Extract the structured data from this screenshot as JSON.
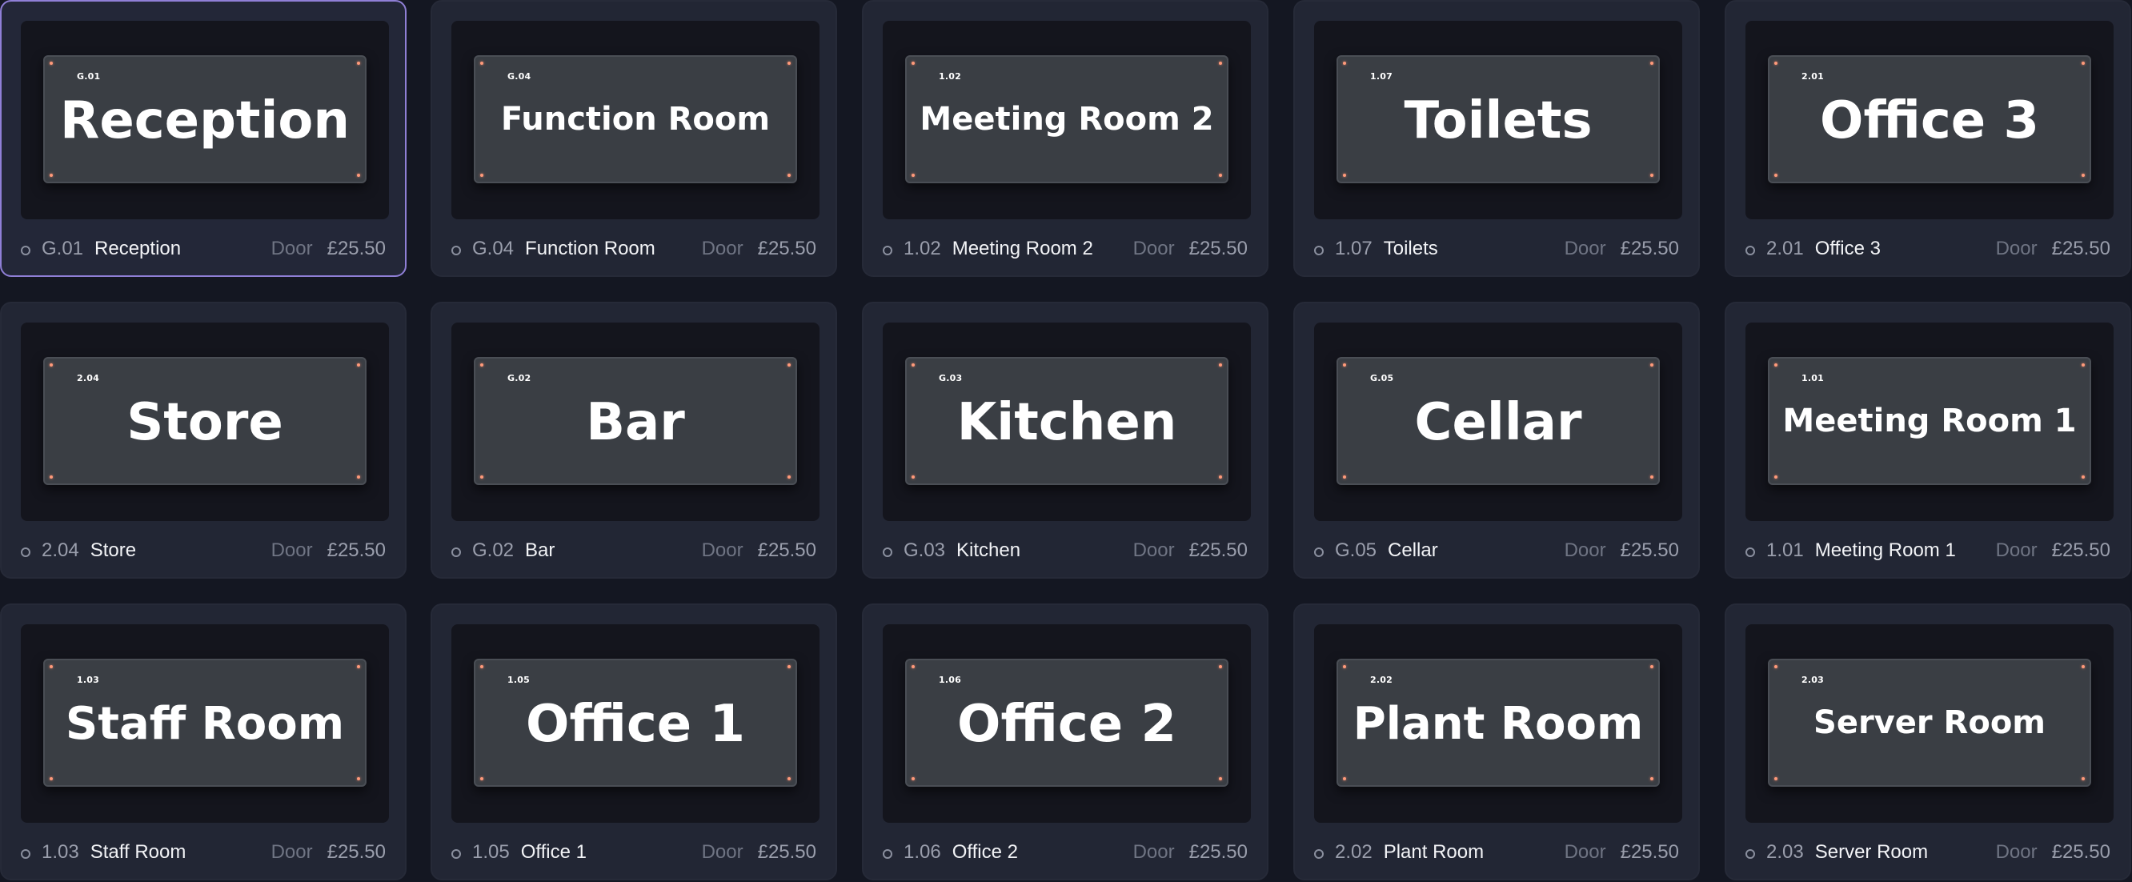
{
  "items": [
    {
      "code": "G.01",
      "name": "Reception",
      "type": "Door",
      "price": "£25.50",
      "selected": true
    },
    {
      "code": "G.04",
      "name": "Function Room",
      "type": "Door",
      "price": "£25.50"
    },
    {
      "code": "1.02",
      "name": "Meeting Room 2",
      "type": "Door",
      "price": "£25.50"
    },
    {
      "code": "1.07",
      "name": "Toilets",
      "type": "Door",
      "price": "£25.50"
    },
    {
      "code": "2.01",
      "name": "Office 3",
      "type": "Door",
      "price": "£25.50"
    },
    {
      "code": "2.04",
      "name": "Store",
      "type": "Door",
      "price": "£25.50"
    },
    {
      "code": "G.02",
      "name": "Bar",
      "type": "Door",
      "price": "£25.50"
    },
    {
      "code": "G.03",
      "name": "Kitchen",
      "type": "Door",
      "price": "£25.50"
    },
    {
      "code": "G.05",
      "name": "Cellar",
      "type": "Door",
      "price": "£25.50"
    },
    {
      "code": "1.01",
      "name": "Meeting Room 1",
      "type": "Door",
      "price": "£25.50"
    },
    {
      "code": "1.03",
      "name": "Staff Room",
      "type": "Door",
      "price": "£25.50"
    },
    {
      "code": "1.05",
      "name": "Office 1",
      "type": "Door",
      "price": "£25.50"
    },
    {
      "code": "1.06",
      "name": "Office 2",
      "type": "Door",
      "price": "£25.50"
    },
    {
      "code": "2.02",
      "name": "Plant Room",
      "type": "Door",
      "price": "£25.50"
    },
    {
      "code": "2.03",
      "name": "Server Room",
      "type": "Door",
      "price": "£25.50"
    }
  ],
  "colors": {
    "background": "#141722",
    "card": "#222634",
    "selected_border": "#8f7fd6",
    "plate": "#3a3e44",
    "screw": "#ff9a7a"
  }
}
